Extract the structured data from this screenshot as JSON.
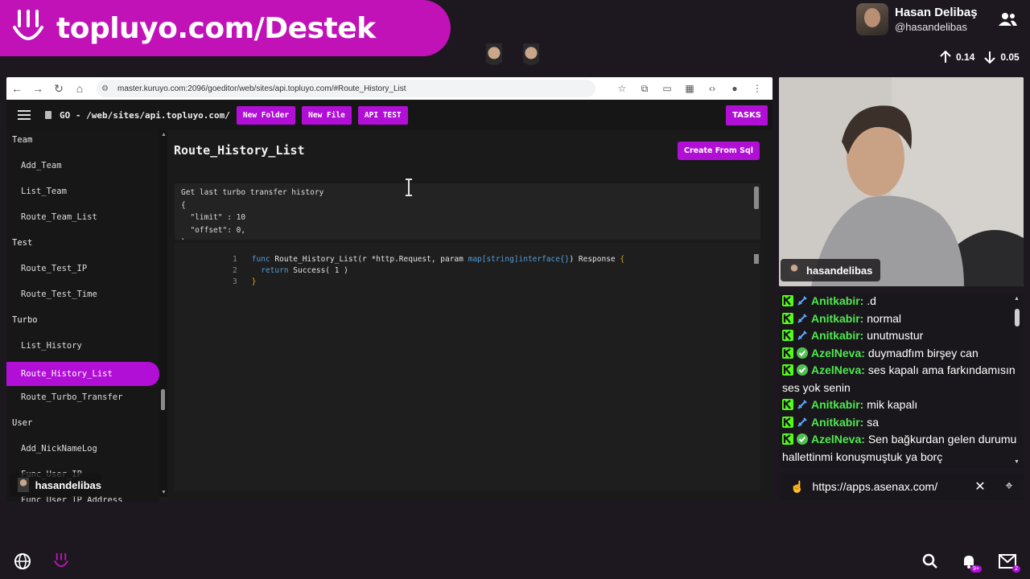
{
  "brand": {
    "text": "topluyo.com/Destek"
  },
  "profile": {
    "name": "Hasan Delibaş",
    "handle": "@hasandelibas",
    "upload": "0.14",
    "download": "0.05"
  },
  "browser": {
    "url": "master.kuruyo.com:2096/goeditor/web/sites/api.topluyo.com/#Route_History_List"
  },
  "app": {
    "path": "GO - /web/sites/api.topluyo.com/",
    "buttons": [
      "New Folder",
      "New File",
      "API TEST"
    ],
    "tasks_label": "TASKS",
    "title": "Route_History_List",
    "create_label": "Create From Sql"
  },
  "sidebar": {
    "entries": [
      {
        "type": "group",
        "label": "Team"
      },
      {
        "type": "item",
        "label": "Add_Team"
      },
      {
        "type": "item",
        "label": "List_Team"
      },
      {
        "type": "item",
        "label": "Route_Team_List"
      },
      {
        "type": "group",
        "label": "Test"
      },
      {
        "type": "item",
        "label": "Route_Test_IP"
      },
      {
        "type": "item",
        "label": "Route_Test_Time"
      },
      {
        "type": "group",
        "label": "Turbo"
      },
      {
        "type": "item",
        "label": "List_History"
      },
      {
        "type": "item",
        "label": "Route_History_List",
        "active": true
      },
      {
        "type": "item",
        "label": "Route_Turbo_Transfer"
      },
      {
        "type": "group",
        "label": "User"
      },
      {
        "type": "item",
        "label": "Add_NickNameLog"
      },
      {
        "type": "item",
        "label": "Func_User_IP"
      },
      {
        "type": "item",
        "label": "Func_User_IP_Address"
      }
    ]
  },
  "description": {
    "lines": [
      "Get last turbo transfer history",
      "{",
      "  \"limit\" : 10",
      "  \"offset\": 0,",
      "}"
    ]
  },
  "editor": {
    "line_numbers": [
      "1",
      "2",
      "3"
    ],
    "line1": {
      "kw": "func",
      "name": " Route_History_List(r *http.Request, param ",
      "type": "map[string]interface{}",
      "rest": ") Response ",
      "brace": "{"
    },
    "line2": {
      "kw": "return",
      "rest": " Success( 1 )"
    },
    "line3": {
      "brace": "}"
    }
  },
  "streamer_chip": "hasandelibas",
  "cam_label": "hasandelibas",
  "chat": [
    {
      "user": "Anitkabir:",
      "text": ".d",
      "badge": "sword"
    },
    {
      "user": "Anitkabir:",
      "text": "normal",
      "badge": "sword"
    },
    {
      "user": "Anitkabir:",
      "text": "unutmustur",
      "badge": "sword"
    },
    {
      "user": "AzelNeva:",
      "text": "duymadfım birşey can",
      "badge": "check"
    },
    {
      "user": "AzelNeva:",
      "text": "ses kapalı ama farkındamısın ses yok senin",
      "badge": "check"
    },
    {
      "user": "Anitkabir:",
      "text": "mik kapalı",
      "badge": "sword"
    },
    {
      "user": "Anitkabir:",
      "text": "sa",
      "badge": "sword"
    },
    {
      "user": "AzelNeva:",
      "text": "Sen bağkurdan gelen durumu hallettinmi konuşmuştuk ya borç",
      "badge": "check"
    }
  ],
  "link_bar": {
    "url": "https://apps.asenax.com/"
  },
  "notifications": {
    "bell_count": "9+",
    "mail_count": "2"
  },
  "colors": {
    "brand": "#c112b8",
    "accent": "#b10ed6",
    "chat_user": "#4fe84f"
  }
}
